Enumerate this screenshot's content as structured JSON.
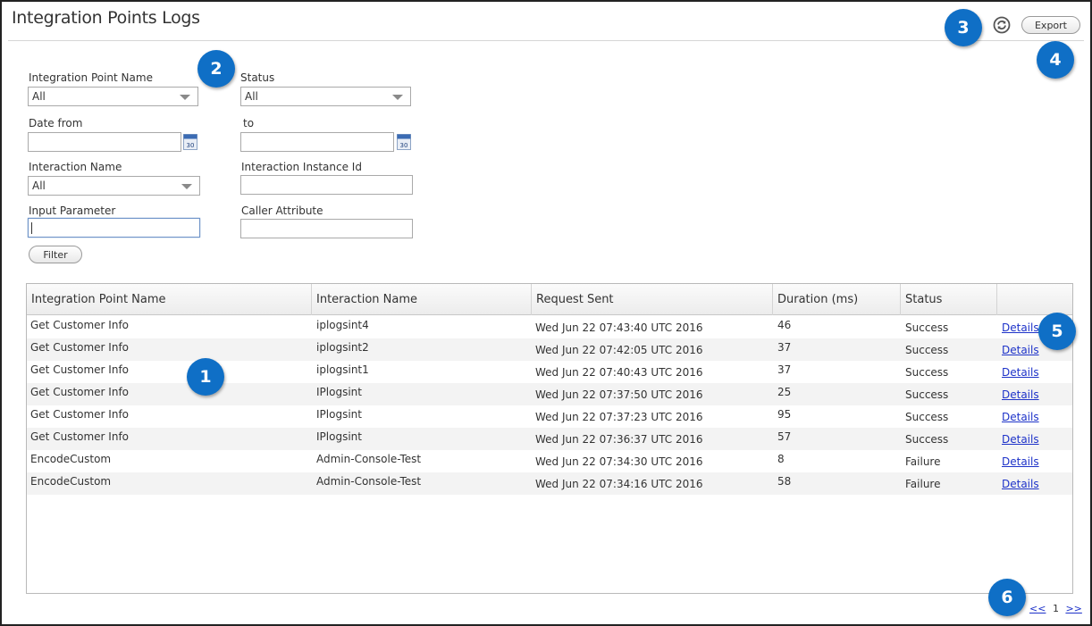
{
  "page": {
    "title": "Integration Points Logs",
    "export_label": "Export",
    "refresh_icon": "refresh-icon"
  },
  "filters": {
    "integration_point_name": {
      "label": "Integration Point Name",
      "value": "All"
    },
    "status": {
      "label": "Status",
      "value": "All"
    },
    "date_from": {
      "label": "Date from",
      "value": ""
    },
    "date_to": {
      "label": "to",
      "value": ""
    },
    "calendar_icon_text": "30",
    "interaction_name": {
      "label": "Interaction Name",
      "value": "All"
    },
    "interaction_instance_id": {
      "label": "Interaction Instance Id",
      "value": ""
    },
    "input_parameter": {
      "label": "Input Parameter",
      "value": ""
    },
    "caller_attribute": {
      "label": "Caller Attribute",
      "value": ""
    },
    "filter_button": "Filter"
  },
  "table": {
    "columns": [
      "Integration Point Name",
      "Interaction Name",
      "Request Sent",
      "Duration (ms)",
      "Status",
      ""
    ],
    "rows": [
      [
        "Get Customer Info",
        "iplogsint4",
        "Wed Jun 22 07:43:40 UTC 2016",
        "46",
        "Success",
        "Details"
      ],
      [
        "Get Customer Info",
        "iplogsint2",
        "Wed Jun 22 07:42:05 UTC 2016",
        "37",
        "Success",
        "Details"
      ],
      [
        "Get Customer Info",
        "iplogsint1",
        "Wed Jun 22 07:40:43 UTC 2016",
        "37",
        "Success",
        "Details"
      ],
      [
        "Get Customer Info",
        "IPlogsint",
        "Wed Jun 22 07:37:50 UTC 2016",
        "25",
        "Success",
        "Details"
      ],
      [
        "Get Customer Info",
        "IPlogsint",
        "Wed Jun 22 07:37:23 UTC 2016",
        "95",
        "Success",
        "Details"
      ],
      [
        "Get Customer Info",
        "IPlogsint",
        "Wed Jun 22 07:36:37 UTC 2016",
        "57",
        "Success",
        "Details"
      ],
      [
        "EncodeCustom",
        "Admin-Console-Test",
        "Wed Jun 22 07:34:30 UTC 2016",
        "8",
        "Failure",
        "Details"
      ],
      [
        "EncodeCustom",
        "Admin-Console-Test",
        "Wed Jun 22 07:34:16 UTC 2016",
        "58",
        "Failure",
        "Details"
      ]
    ]
  },
  "pager": {
    "prev": "<<",
    "current": "1",
    "next": ">>"
  },
  "callouts": [
    "1",
    "2",
    "3",
    "4",
    "5",
    "6"
  ],
  "colors": {
    "callout": "#0f6fc6",
    "link": "#1d32c9",
    "row_alt": "#f3f3f3"
  }
}
